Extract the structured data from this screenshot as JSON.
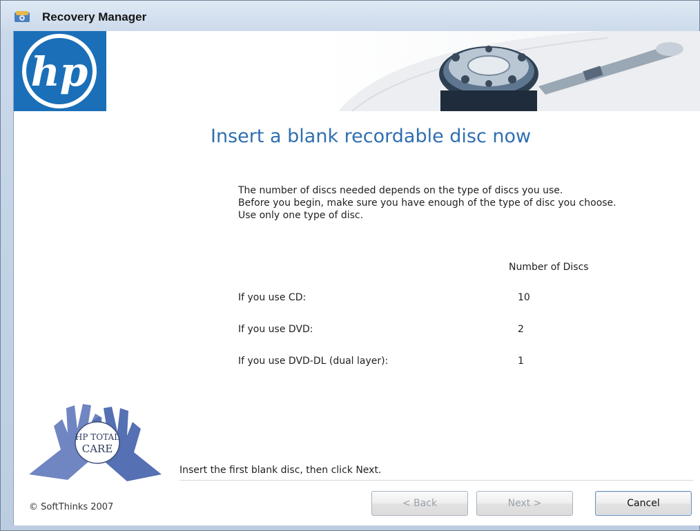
{
  "window": {
    "title": "Recovery Manager"
  },
  "banner": {
    "logo": "hp"
  },
  "content": {
    "title": "Insert a blank recordable disc now",
    "intro": [
      "The number of discs needed depends on the type of discs you use.",
      "Before you begin, make sure you have enough of the type of disc you choose.",
      "Use only one type of disc."
    ],
    "column_header": "Number of Discs",
    "rows": [
      {
        "label": "If you use CD:",
        "value": "10"
      },
      {
        "label": "If you use DVD:",
        "value": "2"
      },
      {
        "label": "If you use DVD-DL (dual layer):",
        "value": "1"
      }
    ],
    "instruction": "Insert the first blank disc, then click Next."
  },
  "branding": {
    "hands_text_line1": "HP TOTAL",
    "hands_text_line2": "CARE"
  },
  "footer": {
    "copyright": "© SoftThinks 2007",
    "back_label": "< Back",
    "next_label": "Next >",
    "cancel_label": "Cancel"
  },
  "colors": {
    "title_blue": "#2f6fb0",
    "hp_blue": "#1b6fb8",
    "hands_blue": "#6f86c2"
  }
}
